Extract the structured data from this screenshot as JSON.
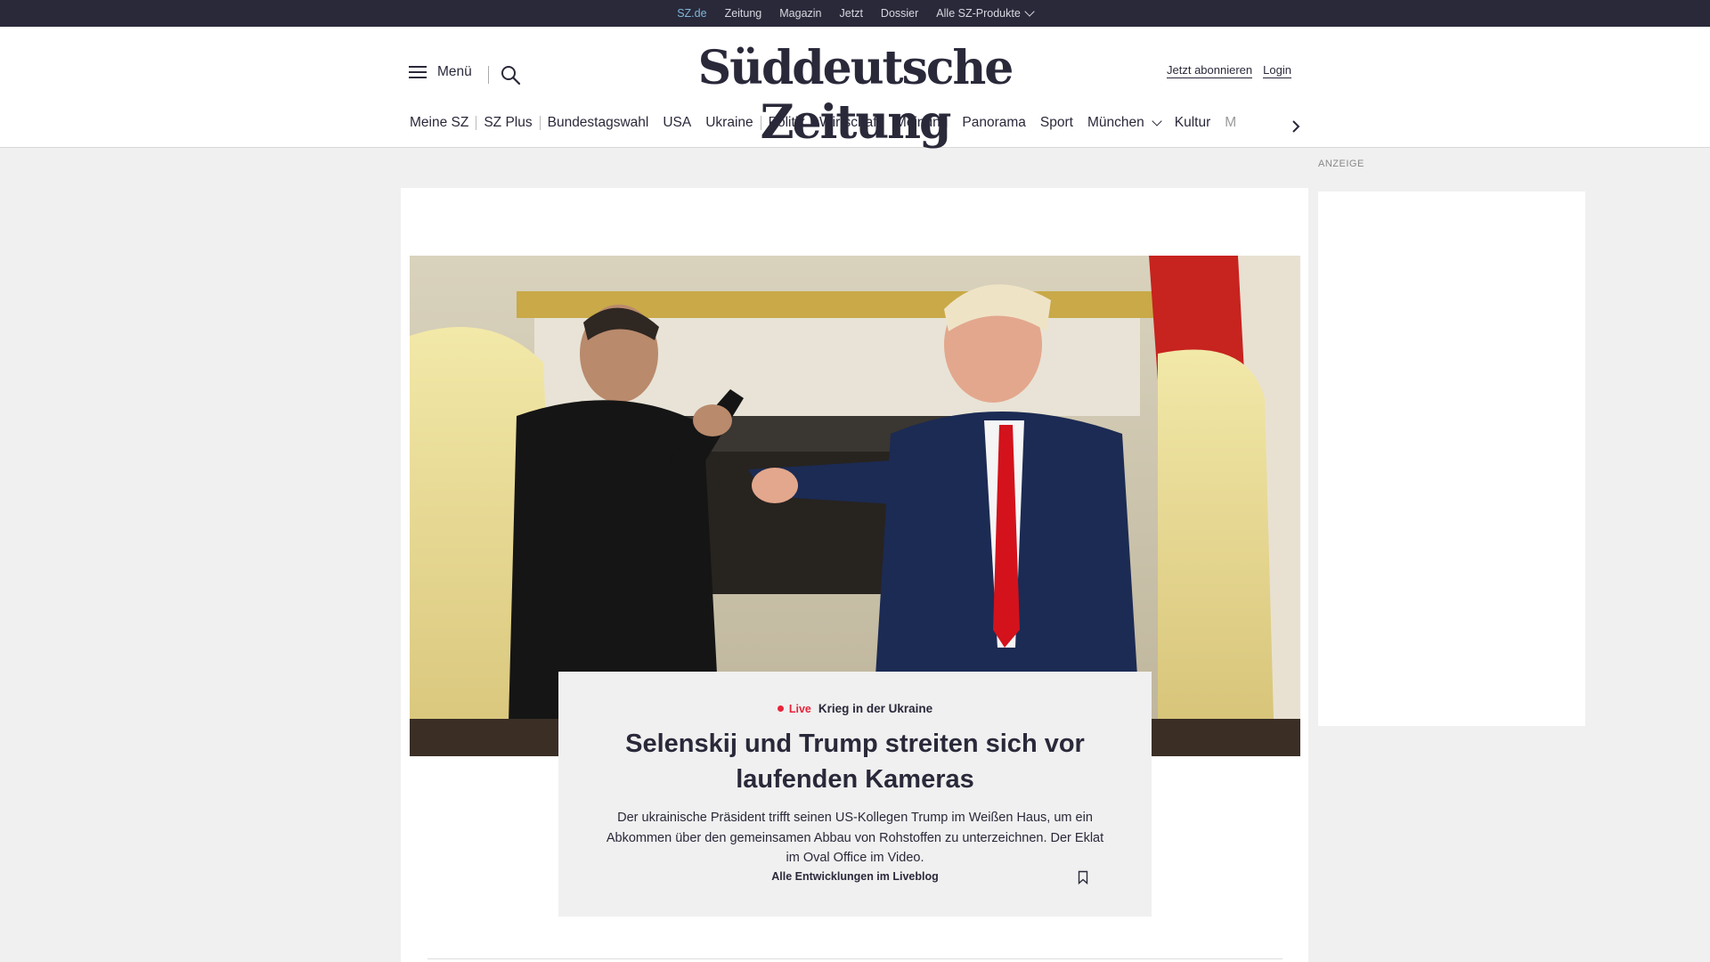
{
  "topbar": {
    "links": [
      "SZ.de",
      "Zeitung",
      "Magazin",
      "Jetzt",
      "Dossier",
      "Alle SZ-Produkte"
    ],
    "active": "SZ.de",
    "background": "#29293a",
    "active_color": "#7fb6d8"
  },
  "header": {
    "menu_label": "Menü",
    "logo": "Süddeutsche Zeitung",
    "subscribe": "Jetzt abonnieren",
    "login": "Login"
  },
  "nav": {
    "items": [
      "Meine SZ",
      "SZ Plus",
      "Bundestagswahl",
      "USA",
      "Ukraine",
      "Politik",
      "Wirtschaft",
      "Meinung",
      "Panorama",
      "Sport",
      "München",
      "Kultur",
      "M"
    ]
  },
  "teaser": {
    "live": "Live",
    "kicker": "Krieg in der Ukraine",
    "headline": "Selenskij und Trump streiten sich vor laufenden Kameras",
    "text": "Der ukrainische Präsident trifft seinen US-Kollegen Trump im Weißen Haus, um ein Abkommen über den gemeinsamen Abbau von Rohstoffen zu unterzeichnen. Der Eklat im Oval Office im Video.",
    "link": "Alle Entwicklungen im Liveblog",
    "live_color": "#e8243a"
  },
  "ad": {
    "label": "ANZEIGE"
  },
  "icons": [
    "hamburger-icon",
    "search-icon",
    "chevron-down-icon",
    "chevron-right-icon",
    "bookmark-icon"
  ]
}
